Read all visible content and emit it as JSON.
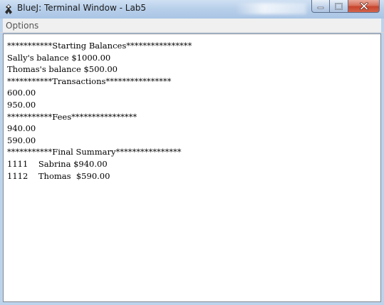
{
  "window": {
    "title": "BlueJ: Terminal Window - Lab5",
    "app_icon": "bluej-icon",
    "controls": {
      "minimize_icon": "minimize-icon",
      "maximize_icon": "maximize-icon",
      "close_icon": "close-icon"
    }
  },
  "menubar": {
    "items": [
      {
        "label": "Options"
      }
    ]
  },
  "terminal": {
    "lines": [
      "***********Starting Balances****************",
      "Sally's balance $1000.00",
      "Thomas's balance $500.00",
      "***********Transactions****************",
      "600.00",
      "950.00",
      "***********Fees****************",
      "940.00",
      "590.00",
      "***********Final Summary****************",
      "1111    Sabrina $940.00",
      "1112    Thomas  $590.00"
    ]
  },
  "colors": {
    "frame": "#bcd3ec",
    "terminal_background": "#ffffff",
    "terminal_text": "#000000",
    "close_button": "#c7442b"
  }
}
